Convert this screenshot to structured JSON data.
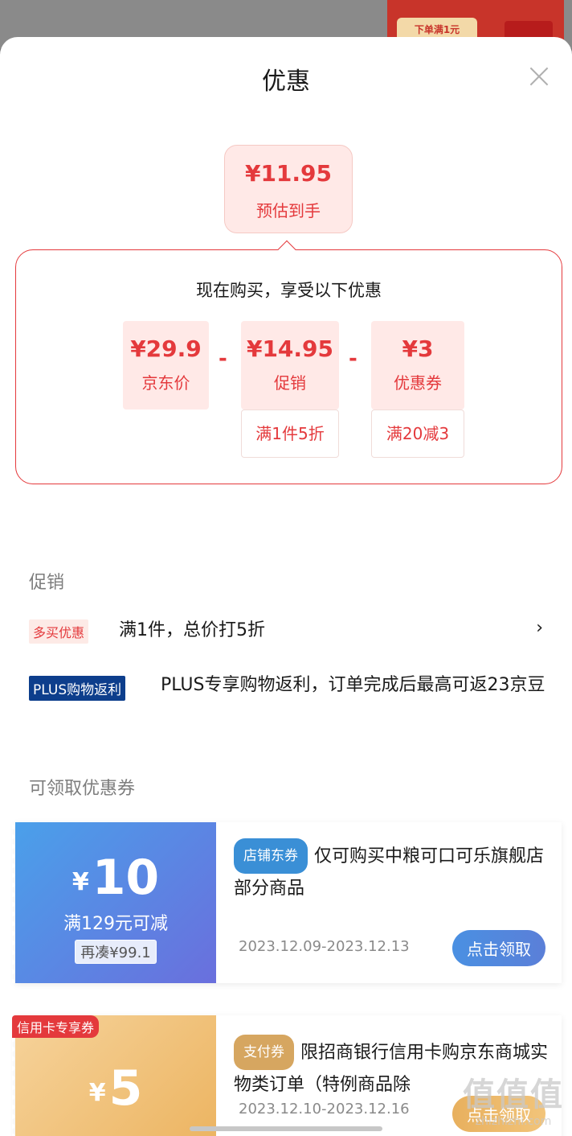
{
  "background": {
    "promo_text": "下单满1元"
  },
  "sheet": {
    "title": "优惠"
  },
  "estimate": {
    "price": "¥11.95",
    "label": "预估到手"
  },
  "breakdown": {
    "title": "现在购买，享受以下优惠",
    "items": [
      {
        "value": "¥29.9",
        "label": "京东价"
      },
      {
        "value": "¥14.95",
        "label": "促销",
        "condition": "满1件5折"
      },
      {
        "value": "¥3",
        "label": "优惠券",
        "condition": "满20减3"
      }
    ],
    "operator": "-"
  },
  "promotions": {
    "section_title": "促销",
    "items": [
      {
        "tag": "多买优惠",
        "text": "满1件，总价打5折",
        "has_arrow": true
      },
      {
        "tag": "PLUS购物返利",
        "text": "PLUS专享购物返利，订单完成后最高可返23京豆",
        "has_arrow": false
      }
    ],
    "arrow": "›"
  },
  "coupons": {
    "section_title": "可领取优惠券",
    "items": [
      {
        "currency": "¥",
        "amount": "10",
        "condition": "满129元可减",
        "extra": "再凑¥99.1",
        "tag": "店铺东券",
        "description": "仅可购买中粮可口可乐旗舰店部分商品",
        "date": "2023.12.09-2023.12.13",
        "button": "点击领取"
      },
      {
        "badge": "信用卡专享券",
        "currency": "¥",
        "amount": "5",
        "tag": "支付券",
        "description": "限招商银行信用卡购京东商城实物类订单（特例商品除",
        "date": "2023.12.10-2023.12.16",
        "button": "点击领取"
      }
    ]
  },
  "watermark": {
    "text": "值值值",
    "url": "zhizhizhi.com"
  }
}
